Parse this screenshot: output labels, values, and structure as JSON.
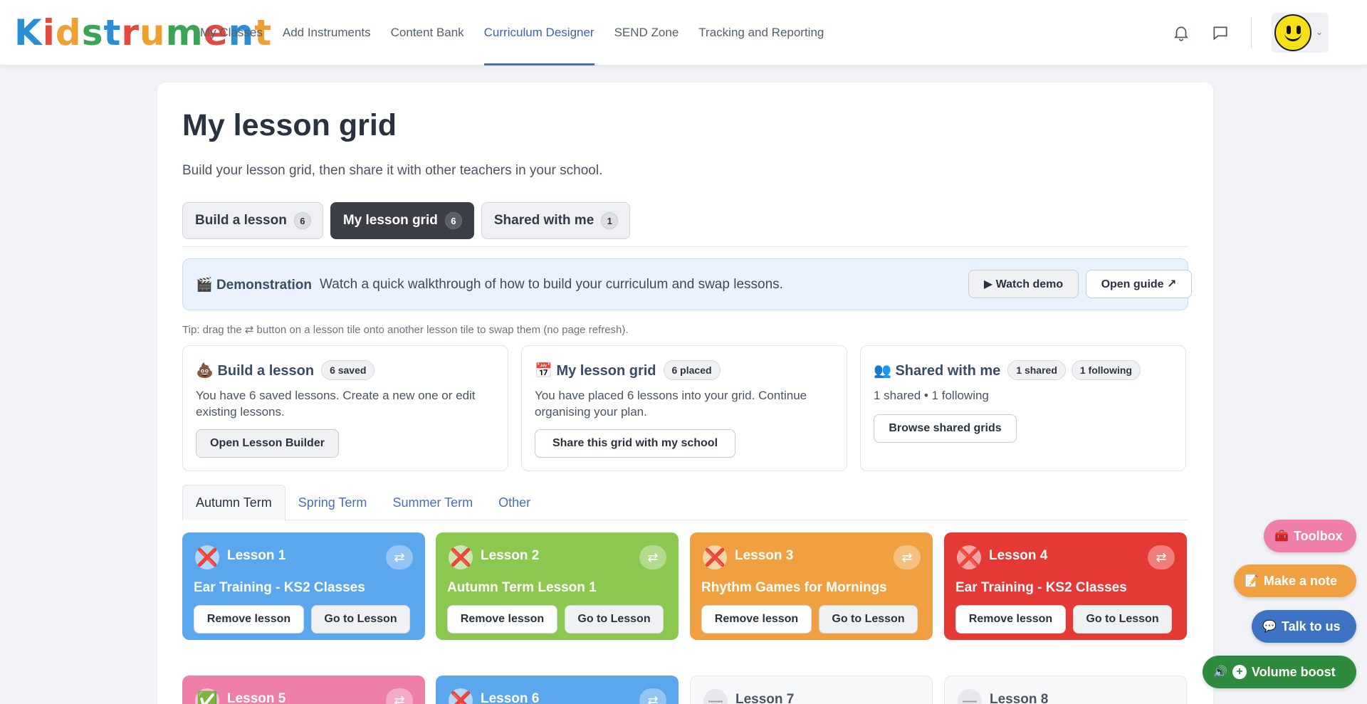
{
  "app": {
    "logo_text": "Kidstrument",
    "logo_letters": [
      {
        "ch": "K",
        "color": "#2a8fd6"
      },
      {
        "ch": "i",
        "color": "#e6483d"
      },
      {
        "ch": "d",
        "color": "#f0a030"
      },
      {
        "ch": "s",
        "color": "#3aa655"
      },
      {
        "ch": "t",
        "color": "#2a8fd6"
      },
      {
        "ch": "r",
        "color": "#e6483d"
      },
      {
        "ch": "u",
        "color": "#f0a030"
      },
      {
        "ch": "m",
        "color": "#3aa655"
      },
      {
        "ch": "e",
        "color": "#e6483d"
      },
      {
        "ch": "n",
        "color": "#2a8fd6"
      },
      {
        "ch": "t",
        "color": "#f0a030"
      }
    ]
  },
  "nav": {
    "items": [
      "My Classes",
      "Add Instruments",
      "Content Bank",
      "Curriculum Designer",
      "SEND Zone",
      "Tracking and Reporting"
    ],
    "active": "Curriculum Designer",
    "icons": [
      "bell-icon",
      "chat-icon"
    ],
    "avatar": "smiley-avatar"
  },
  "page": {
    "title": "My lesson grid",
    "subtitle": "Build your lesson grid, then share it with other teachers in your school."
  },
  "page_tabs": [
    {
      "label": "Build a lesson",
      "count": "6"
    },
    {
      "label": "My lesson grid",
      "count": "6"
    },
    {
      "label": "Shared with me",
      "count": "1"
    }
  ],
  "demo": {
    "icon": "🎬",
    "title": "Demonstration",
    "text": "Watch a quick walkthrough of how to build your curriculum and swap lessons.",
    "watch_label": "▶ Watch demo",
    "guide_label": "Open guide ↗"
  },
  "tip": "Tip: drag the ⇄ button on a lesson tile onto another lesson tile to swap them (no page refresh).",
  "panels": [
    {
      "icon": "💩",
      "title": "Build a lesson",
      "pills": [
        "6 saved"
      ],
      "text": "You have 6 saved lessons. Create a new one or edit existing lessons.",
      "button": "Open Lesson Builder"
    },
    {
      "icon": "📅",
      "title": "My lesson grid",
      "pills": [
        "6 placed"
      ],
      "text": "You have placed 6 lessons into your grid. Continue organising your plan.",
      "button": "Share this grid with my school"
    },
    {
      "icon": "👥",
      "title": "Shared with me",
      "pills": [
        "1 shared",
        "1 following"
      ],
      "text": "1 shared • 1 following",
      "button": "Browse shared grids"
    }
  ],
  "term_tabs": [
    "Autumn Term",
    "Spring Term",
    "Summer Term",
    "Other"
  ],
  "active_term": "Autumn Term",
  "lessons": [
    {
      "label": "Lesson 1",
      "title": "Ear Training - KS2 Classes",
      "color": "#5aa7ee",
      "status": "❌",
      "remove": "Remove lesson",
      "go": "Go to Lesson"
    },
    {
      "label": "Lesson 2",
      "title": "Autumn Term Lesson 1",
      "color": "#8cc850",
      "status": "❌",
      "remove": "Remove lesson",
      "go": "Go to Lesson"
    },
    {
      "label": "Lesson 3",
      "title": "Rhythm Games for Mornings",
      "color": "#f0a040",
      "status": "❌",
      "remove": "Remove lesson",
      "go": "Go to Lesson"
    },
    {
      "label": "Lesson 4",
      "title": "Ear Training - KS2 Classes",
      "color": "#e53935",
      "status": "❌",
      "remove": "Remove lesson",
      "go": "Go to Lesson"
    },
    {
      "label": "Lesson 5",
      "color": "#ef7fa9",
      "status": "✅"
    },
    {
      "label": "Lesson 6",
      "color": "#5aa7ee",
      "status": "❌"
    },
    {
      "label": "Lesson 7",
      "color": "#f7f8fa",
      "status": "—"
    },
    {
      "label": "Lesson 8",
      "color": "#f7f8fa",
      "status": "—"
    }
  ],
  "swap_glyph": "⇄",
  "floating": {
    "toolbox": {
      "icon": "🧰",
      "label": "Toolbox",
      "color": "#ef7fa9"
    },
    "note": {
      "icon": "📝",
      "label": "Make a note",
      "color": "#f0a040"
    },
    "talk": {
      "icon": "💬",
      "label": "Talk to us",
      "color": "#3d73c2"
    },
    "volume": {
      "icon": "🔊",
      "plus": "+",
      "label": "Volume boost",
      "color": "#2e8b3e"
    }
  }
}
